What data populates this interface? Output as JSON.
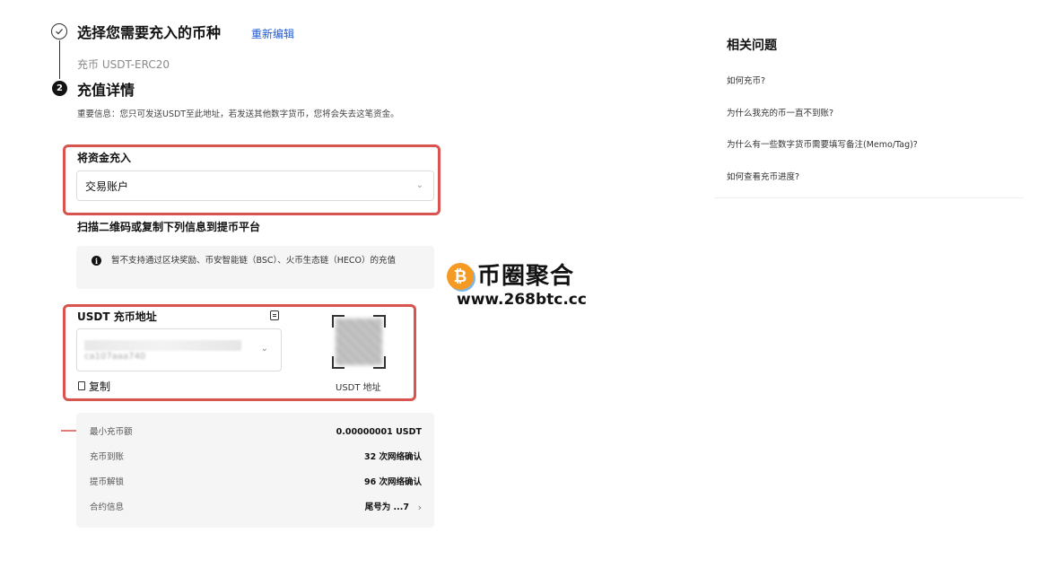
{
  "step1": {
    "title": "选择您需要充入的币种",
    "reedit_label": "重新编辑",
    "selected_coin": "充币 USDT-ERC20"
  },
  "step2": {
    "number": "2",
    "title": "充值详情",
    "important_notice": "重要信息：您只可发送USDT至此地址，若发送其他数字货币，您将会失去这笔资金。"
  },
  "fund": {
    "label": "将资金充入",
    "selected": "交易账户"
  },
  "scan": {
    "title": "扫描二维码或复制下列信息到提币平台",
    "notice": "暂不支持通过区块奖励、币安智能链（BSC）、火币生态链（HECO）的充值"
  },
  "address": {
    "label": "USDT 充币地址",
    "value_partial": "ca107aaa740",
    "copy_label": "复制",
    "qr_label": "USDT 地址"
  },
  "details": {
    "rows": [
      {
        "key": "最小充币额",
        "value": "0.00000001 USDT"
      },
      {
        "key": "充币到账",
        "value": "32 次网络确认"
      },
      {
        "key": "提币解锁",
        "value": "96 次网络确认"
      },
      {
        "key": "合约信息",
        "value": "尾号为 ...7"
      }
    ]
  },
  "watermark": {
    "coin_symbol": "₿",
    "title": "币圈聚合",
    "url": "www.268btc.cc"
  },
  "sidebar": {
    "title": "相关问题",
    "faqs": [
      "如何充币?",
      "为什么我充的币一直不到账?",
      "为什么有一些数字货币需要填写备注(Memo/Tag)?",
      "如何查看充币进度?"
    ]
  },
  "colors": {
    "highlight_red": "#d9534f",
    "link_blue": "#1f5bd6",
    "panel_gray": "#f5f5f5",
    "watermark_orange": "#f59a23"
  }
}
